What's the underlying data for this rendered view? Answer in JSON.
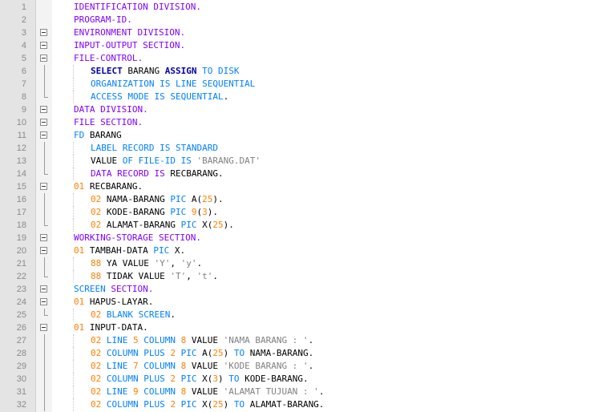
{
  "editor": {
    "colors": {
      "keyword_division": "#8000ff",
      "keyword_statement": "#0000a0",
      "keyword_clause": "#0080ff",
      "number": "#ff8000",
      "string": "#808080",
      "identifier": "#000000",
      "gutter_bg": "#e4e4e4"
    },
    "lines": [
      {
        "no": "1",
        "indent": 0,
        "fold": "none",
        "tokens": [
          {
            "t": "IDENTIFICATION DIVISION.",
            "c": "kw-purple"
          }
        ]
      },
      {
        "no": "2",
        "indent": 0,
        "fold": "none",
        "tokens": [
          {
            "t": "PROGRAM-ID.",
            "c": "kw-purple"
          }
        ]
      },
      {
        "no": "3",
        "indent": 0,
        "fold": "box",
        "tokens": [
          {
            "t": "ENVIRONMENT DIVISION.",
            "c": "kw-purple"
          }
        ]
      },
      {
        "no": "4",
        "indent": 0,
        "fold": "box",
        "tokens": [
          {
            "t": "INPUT-OUTPUT SECTION.",
            "c": "kw-purple"
          }
        ]
      },
      {
        "no": "5",
        "indent": 0,
        "fold": "box",
        "tokens": [
          {
            "t": "FILE-CONTROL.",
            "c": "kw-purple"
          }
        ]
      },
      {
        "no": "6",
        "indent": 1,
        "fold": "line",
        "tokens": [
          {
            "t": "SELECT",
            "c": "kw-navy"
          },
          {
            "t": " BARANG ",
            "c": "ident"
          },
          {
            "t": "ASSIGN",
            "c": "kw-navy"
          },
          {
            "t": " TO DISK",
            "c": "kw-blue"
          }
        ]
      },
      {
        "no": "7",
        "indent": 1,
        "fold": "line",
        "tokens": [
          {
            "t": "ORGANIZATION IS LINE SEQUENTIAL",
            "c": "kw-blue"
          }
        ]
      },
      {
        "no": "8",
        "indent": 1,
        "fold": "end",
        "tokens": [
          {
            "t": "ACCESS MODE IS SEQUENTIAL",
            "c": "kw-blue"
          },
          {
            "t": ".",
            "c": "plain"
          }
        ]
      },
      {
        "no": "9",
        "indent": 0,
        "fold": "box",
        "tokens": [
          {
            "t": "DATA DIVISION.",
            "c": "kw-purple"
          }
        ]
      },
      {
        "no": "10",
        "indent": 0,
        "fold": "box",
        "tokens": [
          {
            "t": "FILE SECTION.",
            "c": "kw-purple"
          }
        ]
      },
      {
        "no": "11",
        "indent": 0,
        "fold": "box",
        "tokens": [
          {
            "t": "FD",
            "c": "kw-blue"
          },
          {
            "t": " BARANG",
            "c": "ident"
          }
        ]
      },
      {
        "no": "12",
        "indent": 1,
        "fold": "line",
        "tokens": [
          {
            "t": "LABEL RECORD IS STANDARD",
            "c": "kw-blue"
          }
        ]
      },
      {
        "no": "13",
        "indent": 1,
        "fold": "line",
        "tokens": [
          {
            "t": "VALUE",
            "c": "ident"
          },
          {
            "t": " OF FILE-ID IS ",
            "c": "kw-blue"
          },
          {
            "t": "'BARANG.DAT'",
            "c": "str"
          }
        ]
      },
      {
        "no": "14",
        "indent": 1,
        "fold": "end",
        "tokens": [
          {
            "t": "DATA RECORD IS",
            "c": "kw-purple"
          },
          {
            "t": " RECBARANG.",
            "c": "ident"
          }
        ]
      },
      {
        "no": "15",
        "indent": 0,
        "fold": "box",
        "tokens": [
          {
            "t": "01",
            "c": "num"
          },
          {
            "t": " RECBARANG.",
            "c": "ident"
          }
        ]
      },
      {
        "no": "16",
        "indent": 1,
        "fold": "line",
        "tokens": [
          {
            "t": "02",
            "c": "num"
          },
          {
            "t": " NAMA-BARANG ",
            "c": "ident"
          },
          {
            "t": "PIC",
            "c": "kw-blue"
          },
          {
            "t": " A(",
            "c": "ident"
          },
          {
            "t": "25",
            "c": "num"
          },
          {
            "t": ").",
            "c": "ident"
          }
        ]
      },
      {
        "no": "17",
        "indent": 1,
        "fold": "line",
        "tokens": [
          {
            "t": "02",
            "c": "num"
          },
          {
            "t": " KODE-BARANG ",
            "c": "ident"
          },
          {
            "t": "PIC",
            "c": "kw-blue"
          },
          {
            "t": " ",
            "c": "ident"
          },
          {
            "t": "9",
            "c": "num"
          },
          {
            "t": "(",
            "c": "ident"
          },
          {
            "t": "3",
            "c": "num"
          },
          {
            "t": ").",
            "c": "ident"
          }
        ]
      },
      {
        "no": "18",
        "indent": 1,
        "fold": "end",
        "tokens": [
          {
            "t": "02",
            "c": "num"
          },
          {
            "t": " ALAMAT-BARANG ",
            "c": "ident"
          },
          {
            "t": "PIC",
            "c": "kw-blue"
          },
          {
            "t": " X(",
            "c": "ident"
          },
          {
            "t": "25",
            "c": "num"
          },
          {
            "t": ").",
            "c": "ident"
          }
        ]
      },
      {
        "no": "19",
        "indent": 0,
        "fold": "box",
        "tokens": [
          {
            "t": "WORKING-STORAGE SECTION.",
            "c": "kw-purple"
          }
        ]
      },
      {
        "no": "20",
        "indent": 0,
        "fold": "box",
        "tokens": [
          {
            "t": "01",
            "c": "num"
          },
          {
            "t": " TAMBAH-DATA ",
            "c": "ident"
          },
          {
            "t": "PIC",
            "c": "kw-blue"
          },
          {
            "t": " X.",
            "c": "ident"
          }
        ]
      },
      {
        "no": "21",
        "indent": 1,
        "fold": "line",
        "tokens": [
          {
            "t": "88",
            "c": "num"
          },
          {
            "t": " YA VALUE ",
            "c": "ident"
          },
          {
            "t": "'Y'",
            "c": "str"
          },
          {
            "t": ", ",
            "c": "ident"
          },
          {
            "t": "'y'",
            "c": "str"
          },
          {
            "t": ".",
            "c": "ident"
          }
        ]
      },
      {
        "no": "22",
        "indent": 1,
        "fold": "end",
        "tokens": [
          {
            "t": "88",
            "c": "num"
          },
          {
            "t": " TIDAK VALUE ",
            "c": "ident"
          },
          {
            "t": "'T'",
            "c": "str"
          },
          {
            "t": ", ",
            "c": "ident"
          },
          {
            "t": "'t'",
            "c": "str"
          },
          {
            "t": ".",
            "c": "ident"
          }
        ]
      },
      {
        "no": "23",
        "indent": 0,
        "fold": "box",
        "tokens": [
          {
            "t": "SCREEN",
            "c": "kw-blue"
          },
          {
            "t": " SECTION.",
            "c": "kw-purple"
          }
        ]
      },
      {
        "no": "24",
        "indent": 0,
        "fold": "box",
        "tokens": [
          {
            "t": "01",
            "c": "num"
          },
          {
            "t": " HAPUS-LAYAR.",
            "c": "ident"
          }
        ]
      },
      {
        "no": "25",
        "indent": 1,
        "fold": "end",
        "tokens": [
          {
            "t": "02",
            "c": "num"
          },
          {
            "t": " BLANK SCREEN",
            "c": "kw-blue"
          },
          {
            "t": ".",
            "c": "ident"
          }
        ]
      },
      {
        "no": "26",
        "indent": 0,
        "fold": "box",
        "tokens": [
          {
            "t": "01",
            "c": "num"
          },
          {
            "t": " INPUT-DATA.",
            "c": "ident"
          }
        ]
      },
      {
        "no": "27",
        "indent": 1,
        "fold": "line",
        "tokens": [
          {
            "t": "02",
            "c": "num"
          },
          {
            "t": " LINE ",
            "c": "kw-blue"
          },
          {
            "t": "5",
            "c": "num"
          },
          {
            "t": " COLUMN ",
            "c": "kw-blue"
          },
          {
            "t": "8",
            "c": "num"
          },
          {
            "t": " VALUE ",
            "c": "ident"
          },
          {
            "t": "'NAMA BARANG : '",
            "c": "str"
          },
          {
            "t": ".",
            "c": "ident"
          }
        ]
      },
      {
        "no": "28",
        "indent": 1,
        "fold": "line",
        "tokens": [
          {
            "t": "02",
            "c": "num"
          },
          {
            "t": " COLUMN PLUS ",
            "c": "kw-blue"
          },
          {
            "t": "2",
            "c": "num"
          },
          {
            "t": " PIC ",
            "c": "kw-blue"
          },
          {
            "t": "A(",
            "c": "ident"
          },
          {
            "t": "25",
            "c": "num"
          },
          {
            "t": ") ",
            "c": "ident"
          },
          {
            "t": "TO",
            "c": "kw-blue"
          },
          {
            "t": " NAMA-BARANG.",
            "c": "ident"
          }
        ]
      },
      {
        "no": "29",
        "indent": 1,
        "fold": "line",
        "tokens": [
          {
            "t": "02",
            "c": "num"
          },
          {
            "t": " LINE ",
            "c": "kw-blue"
          },
          {
            "t": "7",
            "c": "num"
          },
          {
            "t": " COLUMN ",
            "c": "kw-blue"
          },
          {
            "t": "8",
            "c": "num"
          },
          {
            "t": " VALUE ",
            "c": "ident"
          },
          {
            "t": "'KODE BARANG : '",
            "c": "str"
          },
          {
            "t": ".",
            "c": "ident"
          }
        ]
      },
      {
        "no": "30",
        "indent": 1,
        "fold": "line",
        "tokens": [
          {
            "t": "02",
            "c": "num"
          },
          {
            "t": " COLUMN PLUS ",
            "c": "kw-blue"
          },
          {
            "t": "2",
            "c": "num"
          },
          {
            "t": " PIC ",
            "c": "kw-blue"
          },
          {
            "t": "X(",
            "c": "ident"
          },
          {
            "t": "3",
            "c": "num"
          },
          {
            "t": ") ",
            "c": "ident"
          },
          {
            "t": "TO",
            "c": "kw-blue"
          },
          {
            "t": " KODE-BARANG.",
            "c": "ident"
          }
        ]
      },
      {
        "no": "31",
        "indent": 1,
        "fold": "line",
        "tokens": [
          {
            "t": "02",
            "c": "num"
          },
          {
            "t": " LINE ",
            "c": "kw-blue"
          },
          {
            "t": "9",
            "c": "num"
          },
          {
            "t": " COLUMN ",
            "c": "kw-blue"
          },
          {
            "t": "8",
            "c": "num"
          },
          {
            "t": " VALUE ",
            "c": "ident"
          },
          {
            "t": "'ALAMAT TUJUAN : '",
            "c": "str"
          },
          {
            "t": ".",
            "c": "ident"
          }
        ]
      },
      {
        "no": "32",
        "indent": 1,
        "fold": "line",
        "tokens": [
          {
            "t": "02",
            "c": "num"
          },
          {
            "t": " COLUMN PLUS ",
            "c": "kw-blue"
          },
          {
            "t": "2",
            "c": "num"
          },
          {
            "t": " PIC ",
            "c": "kw-blue"
          },
          {
            "t": "X(",
            "c": "ident"
          },
          {
            "t": "25",
            "c": "num"
          },
          {
            "t": ") ",
            "c": "ident"
          },
          {
            "t": "TO",
            "c": "kw-blue"
          },
          {
            "t": " ALAMAT-BARANG.",
            "c": "ident"
          }
        ]
      }
    ]
  }
}
